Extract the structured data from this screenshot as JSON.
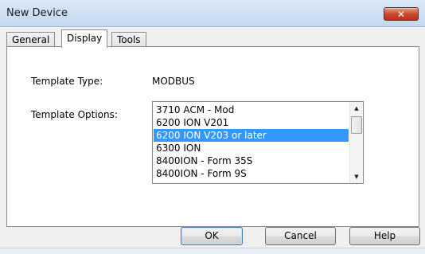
{
  "window": {
    "title": "New Device",
    "close_icon": "close-icon"
  },
  "tabs": [
    {
      "label": "General",
      "active": false
    },
    {
      "label": "Display",
      "active": true
    },
    {
      "label": "Tools",
      "active": false
    }
  ],
  "display": {
    "template_type_label": "Template Type:",
    "template_type_value": "MODBUS",
    "template_options_label": "Template Options:",
    "options": [
      "3710 ACM - Mod",
      "6200 ION V201",
      "6200 ION V203 or later",
      "6300 ION",
      "8400ION - Form 35S",
      "8400ION - Form 9S"
    ],
    "selected_option": "6200 ION V203 or later"
  },
  "buttons": {
    "ok": "OK",
    "cancel": "Cancel",
    "help": "Help"
  },
  "colors": {
    "selection": "#3399ff",
    "close_button": "#c7452c"
  }
}
